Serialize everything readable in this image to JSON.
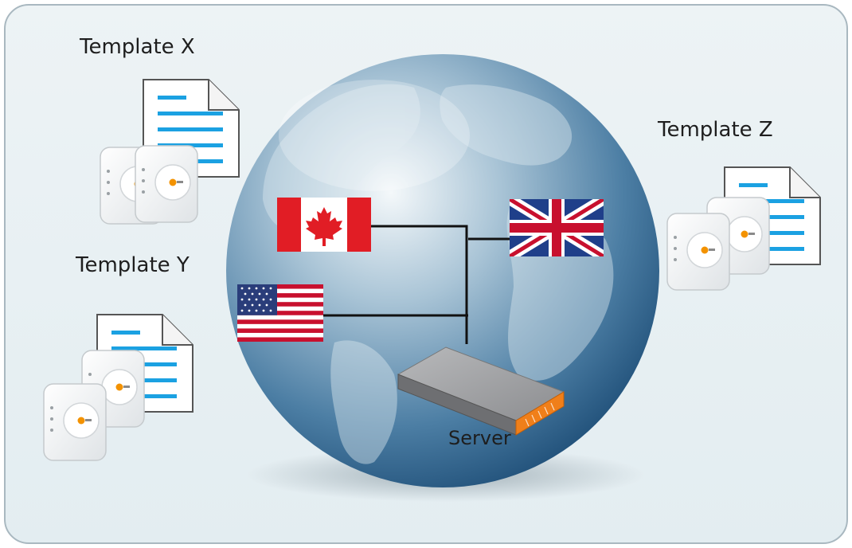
{
  "labels": {
    "template_x": "Template X",
    "template_y": "Template Y",
    "template_z": "Template Z",
    "server": "Server"
  },
  "colors": {
    "panel_background": "#e9f1f4",
    "panel_border": "#a9b8c0",
    "document_lines": "#1ba1e2",
    "device_accent": "#f39200",
    "server_accent": "#f07f1a",
    "connector_lines": "#111111",
    "globe_blue": "#3a6f97"
  },
  "flags": [
    "canada-flag",
    "usa-flag",
    "uk-flag"
  ],
  "icons": [
    "document-icon",
    "access-point-icon",
    "server-icon",
    "globe"
  ]
}
